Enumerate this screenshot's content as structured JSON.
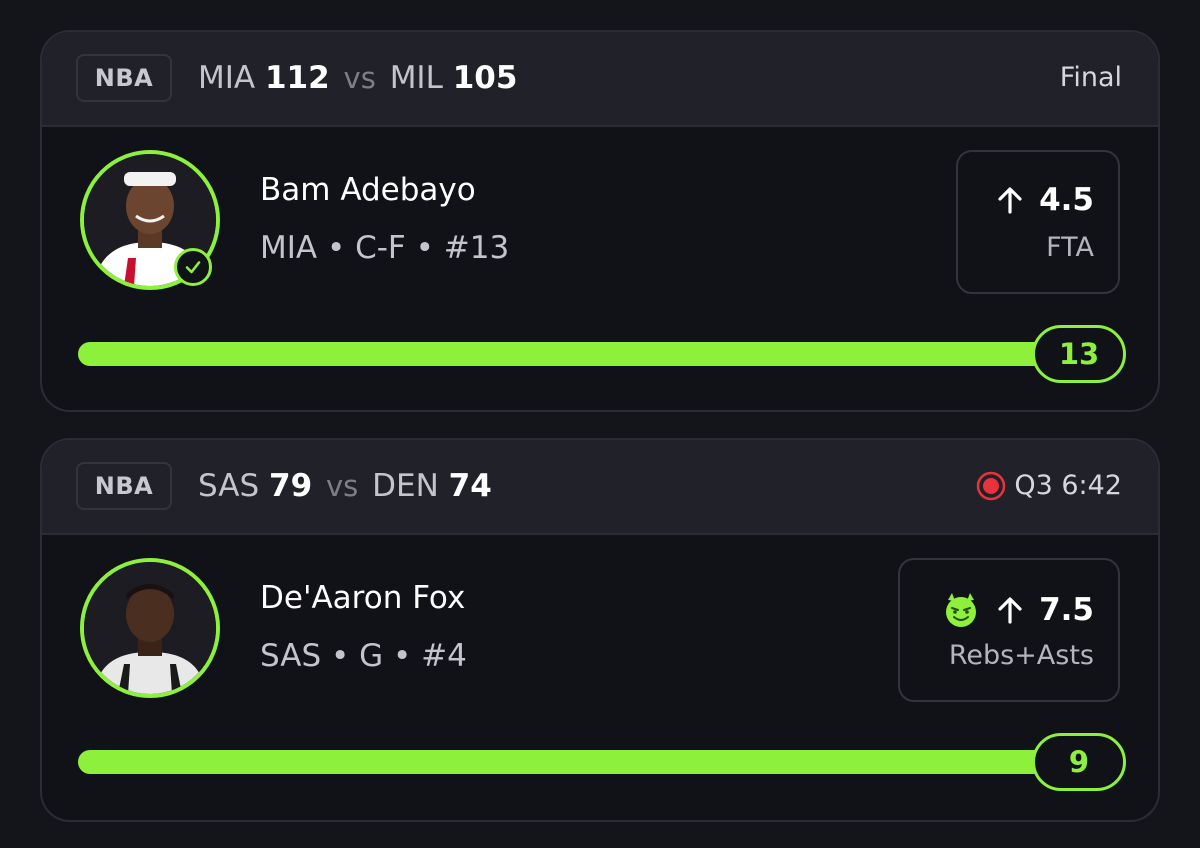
{
  "colors": {
    "accent": "#8df13c",
    "live": "#e8323c",
    "background": "#14141b",
    "card": "#111118"
  },
  "cards": [
    {
      "league": "NBA",
      "home_team": "MIA",
      "home_score": "112",
      "vs": "vs",
      "away_team": "MIL",
      "away_score": "105",
      "status": "Final",
      "status_icon": null,
      "player": {
        "name": "Bam Adebayo",
        "meta": "MIA • C-F • #13",
        "avatar_icon": "player-headshot",
        "verified_icon": "check-circle-icon"
      },
      "prop": {
        "direction_icon": "arrow-up-icon",
        "line": "4.5",
        "stat": "FTA",
        "badge_icon": null
      },
      "progress": {
        "value": "13",
        "fraction": 1.0
      }
    },
    {
      "league": "NBA",
      "home_team": "SAS",
      "home_score": "79",
      "vs": "vs",
      "away_team": "DEN",
      "away_score": "74",
      "status": "Q3 6:42",
      "status_icon": "live-indicator-icon",
      "player": {
        "name": "De'Aaron Fox",
        "meta": "SAS • G • #4",
        "avatar_icon": "player-headshot",
        "verified_icon": null
      },
      "prop": {
        "direction_icon": "arrow-up-icon",
        "line": "7.5",
        "stat": "Rebs+Asts",
        "badge_icon": "devil-emoji-icon"
      },
      "progress": {
        "value": "9",
        "fraction": 1.0
      }
    }
  ]
}
